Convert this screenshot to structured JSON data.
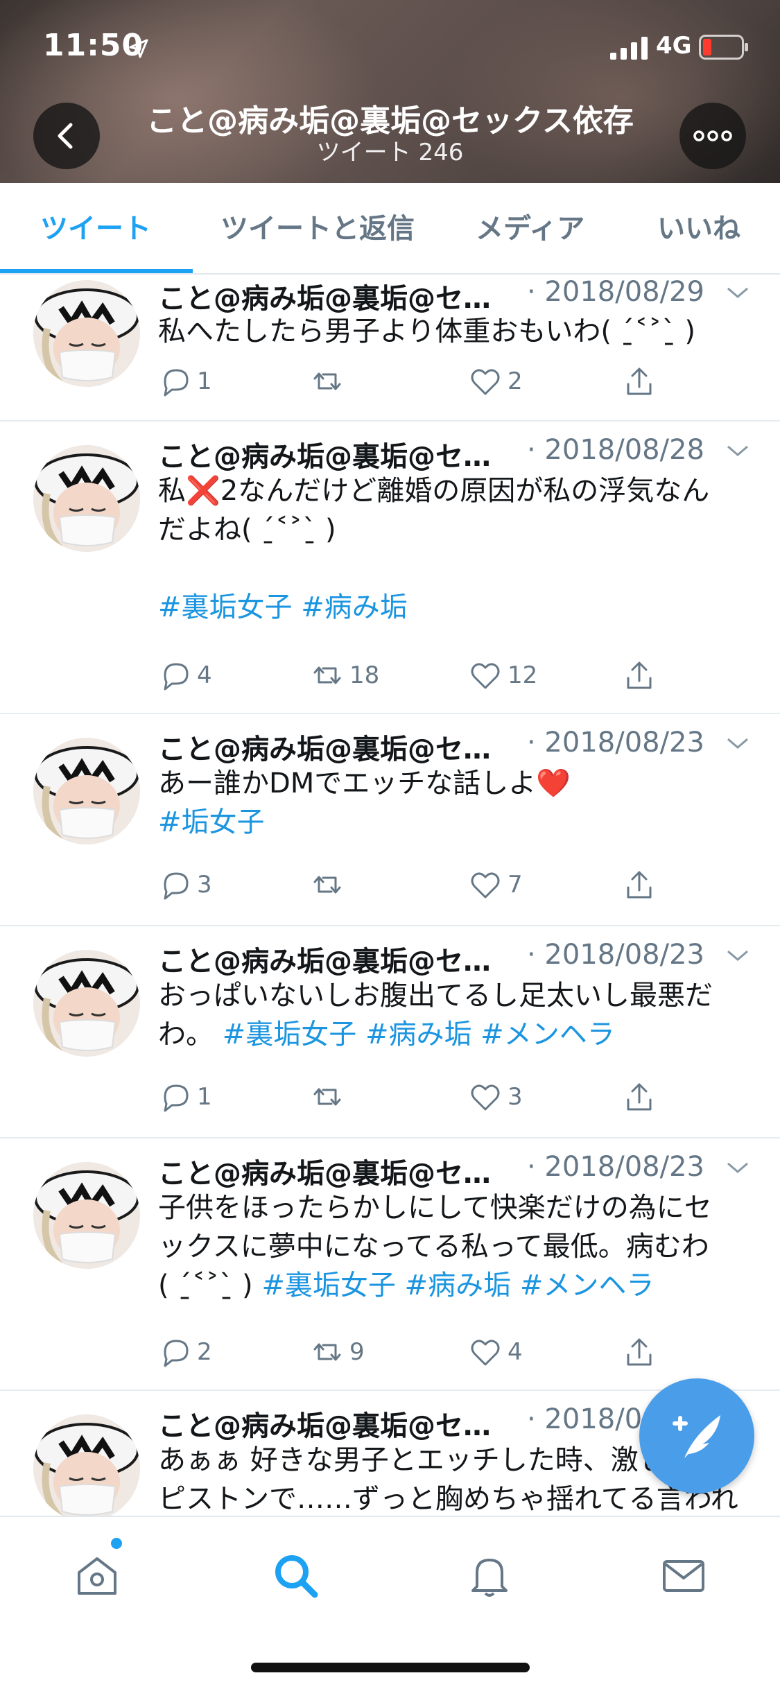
{
  "status_bar": {
    "time": "11:50",
    "network": "4G",
    "icons": [
      "location-arrow-icon",
      "signal-icon",
      "battery-low-icon"
    ]
  },
  "header": {
    "title": "こと@病み垢@裏垢@セックス依存",
    "subtitle": "ツイート 246",
    "icons": [
      "back-chevron-icon",
      "more-dots-icon"
    ]
  },
  "tabs": [
    {
      "label": "ツイート",
      "active": true
    },
    {
      "label": "ツイートと返信",
      "active": false
    },
    {
      "label": "メディア",
      "active": false
    },
    {
      "label": "いいね",
      "active": false
    }
  ],
  "tweets": [
    {
      "name": "こと@病み垢@裏垢@セ…",
      "date": "· 2018/08/29",
      "lines": [
        "私へたしたら男子より体重おもいわ( ˊ̱˂˃ˋ̱ )"
      ],
      "reply_count": "1",
      "retweet_count": "",
      "like_count": "2"
    },
    {
      "name": "こと@病み垢@裏垢@セ…",
      "date": "· 2018/08/28",
      "lines": [
        "私❌2なんだけど離婚の原因が私の浮気なん",
        "だよね( ˊ̱˂˃ˋ̱ )",
        "",
        ""
      ],
      "hashtags": "#裏垢女子 #病み垢",
      "reply_count": "4",
      "retweet_count": "18",
      "like_count": "12"
    },
    {
      "name": "こと@病み垢@裏垢@セ…",
      "date": "· 2018/08/23",
      "lines": [
        "あー誰かDMでエッチな話しよ❤️"
      ],
      "hashtags": "#垢女子",
      "reply_count": "3",
      "retweet_count": "",
      "like_count": "7"
    },
    {
      "name": "こと@病み垢@裏垢@セ…",
      "date": "· 2018/08/23",
      "lines": [
        "おっぱいないしお腹出てるし足太いし最悪だ"
      ],
      "line2_prefix": "わ。",
      "hashtags": "#裏垢女子 #病み垢 #メンヘラ",
      "reply_count": "1",
      "retweet_count": "",
      "like_count": "3"
    },
    {
      "name": "こと@病み垢@裏垢@セ…",
      "date": "· 2018/08/23",
      "lines": [
        "子供をほったらかしにして快楽だけの為にセ",
        "ックスに夢中になってる私って最低。病むわ"
      ],
      "line3_prefix": "( ˊ̱˂˃ˋ̱ )",
      "hashtags": "#裏垢女子 #病み垢 #メンヘラ",
      "reply_count": "2",
      "retweet_count": "9",
      "like_count": "4"
    },
    {
      "name": "こと@病み垢@裏垢@セ…",
      "date": "· 2018/0",
      "lines": [
        "あぁぁ 好きな男子とエッチした時、激し",
        "ピストンで……ずっと胸めちゃ揺れてる言われ"
      ]
    }
  ],
  "fab": {
    "icon": "compose-feather-icon"
  },
  "bottom_nav": [
    {
      "name": "home",
      "icon": "home-icon",
      "active": false,
      "badge": true
    },
    {
      "name": "search",
      "icon": "search-icon",
      "active": true
    },
    {
      "name": "notifications",
      "icon": "bell-icon",
      "active": false
    },
    {
      "name": "messages",
      "icon": "mail-icon",
      "active": false
    }
  ],
  "colors": {
    "accent": "#1da1f2",
    "hashtag": "#1b95e0",
    "secondary_text": "#657786",
    "fab": "#4a9de8"
  }
}
